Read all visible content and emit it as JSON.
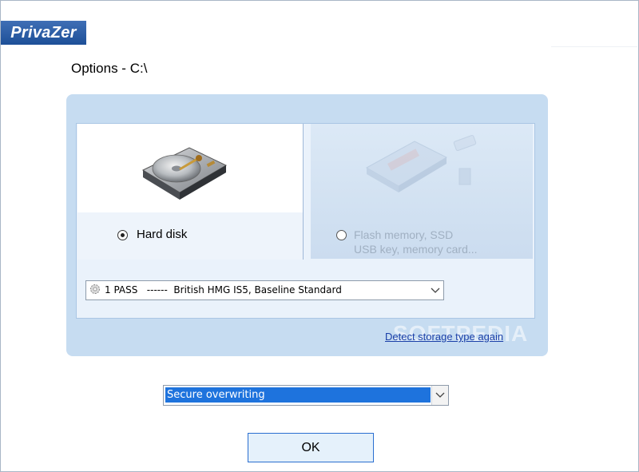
{
  "app": {
    "logo_text": "PrivaZer"
  },
  "header": {
    "title": "Options - C:\\"
  },
  "storage_types": {
    "hard_disk": {
      "label": "Hard disk",
      "selected": true,
      "icon": "hard-disk-drive-icon"
    },
    "flash": {
      "label_line1": "Flash memory, SSD",
      "label_line2": "USB key, memory card...",
      "selected": false,
      "enabled": false,
      "icon": "ssd-usb-icon"
    }
  },
  "pass_select": {
    "value": "1 PASS   ------  British HMG IS5, Baseline Standard",
    "icon": "gear-icon"
  },
  "detect_link": {
    "label": "Detect storage type again"
  },
  "watermark": {
    "text": "SOFTPEDIA"
  },
  "mode_select": {
    "value": "Secure overwriting"
  },
  "ok_button": {
    "label": "OK"
  },
  "colors": {
    "panel": "#c6dcf1",
    "accent": "#1e73dd",
    "logo": "#2a5ca6",
    "link": "#1a3fa8"
  }
}
